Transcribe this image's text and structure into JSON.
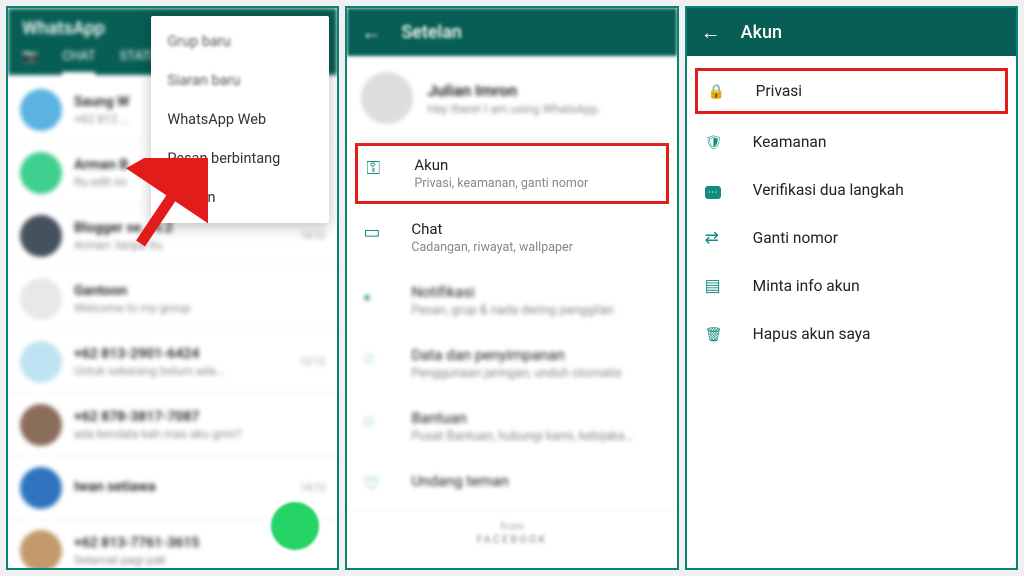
{
  "panel1": {
    "app_title": "WhatsApp",
    "tab_chat": "CHAT",
    "menu": {
      "new_group": "Grup baru",
      "new_broadcast": "Siaran baru",
      "whatsapp_web": "WhatsApp Web",
      "starred": "Pesan berbintang",
      "settings": "Setelan"
    },
    "chats": [
      {
        "name": "Saung W",
        "msg": "+62 812 …",
        "time": ""
      },
      {
        "name": "Arman B",
        "msg": "Ru edit ini",
        "time": ""
      },
      {
        "name": "Blogger se… v.2",
        "msg": "Arman: tanpa itu",
        "time": "14:12"
      },
      {
        "name": "Gantoon",
        "msg": "Welcome to my group",
        "time": ""
      },
      {
        "name": "+62 813-2901-6424",
        "msg": "Untuk sekarang belum ada…",
        "time": "12:12"
      },
      {
        "name": "+62 878-3817-7087",
        "msg": "ada kendala kah mas aku gmn?",
        "time": ""
      },
      {
        "name": "Iwan setiawa",
        "msg": "",
        "time": "14:12"
      },
      {
        "name": "+62 813-7761-3615",
        "msg": "Selamat pagi pak",
        "time": ""
      }
    ]
  },
  "panel2": {
    "header": "Setelan",
    "profile_name": "Julian Imron",
    "profile_status": "Hey there! I am using WhatsApp.",
    "items": {
      "account_label": "Akun",
      "account_sub": "Privasi, keamanan, ganti nomor",
      "chat_label": "Chat",
      "chat_sub": "Cadangan, riwayat, wallpaper",
      "notif_label": "Notifikasi",
      "notif_sub": "Pesan, grup & nada dering panggilan",
      "data_label": "Data dan penyimpanan",
      "data_sub": "Penggunaan jaringan, unduh otomatis",
      "help_label": "Bantuan",
      "help_sub": "Pusat Bantuan, hubungi kami, kebijaka…",
      "invite_label": "Undang teman"
    },
    "footer_from": "from",
    "footer_brand": "FACEBOOK"
  },
  "panel3": {
    "header": "Akun",
    "items": {
      "privacy": "Privasi",
      "security": "Keamanan",
      "two_step": "Verifikasi dua langkah",
      "change_number": "Ganti nomor",
      "request_info": "Minta info akun",
      "delete": "Hapus akun saya"
    }
  }
}
